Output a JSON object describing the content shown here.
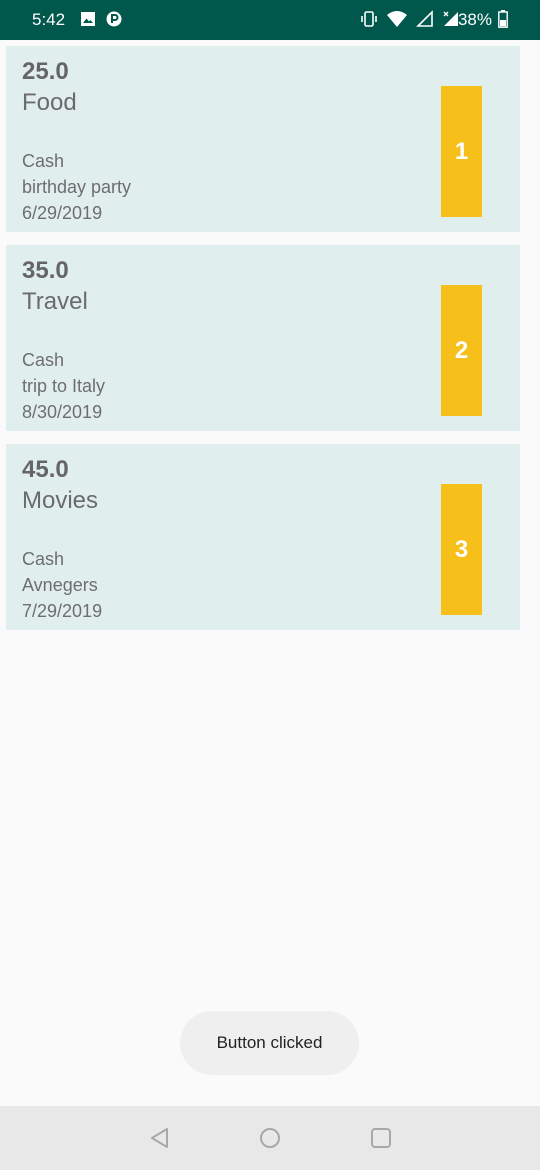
{
  "status_bar": {
    "time": "5:42",
    "battery": "38%",
    "left_icons": [
      "image-icon",
      "p-icon"
    ],
    "right_icons": [
      "vibrate-icon",
      "wifi-icon",
      "signal-icon",
      "signal-x-icon"
    ],
    "background": "#00574b"
  },
  "expenses": [
    {
      "amount": "25.0",
      "category": "Food",
      "method": "Cash",
      "description": "birthday party",
      "date": "6/29/2019",
      "badge": "1"
    },
    {
      "amount": "35.0",
      "category": "Travel",
      "method": "Cash",
      "description": "trip to Italy",
      "date": "8/30/2019",
      "badge": "2"
    },
    {
      "amount": "45.0",
      "category": "Movies",
      "method": "Cash",
      "description": "Avnegers",
      "date": "7/29/2019",
      "badge": "3"
    }
  ],
  "toast": {
    "message": "Button clicked"
  },
  "colors": {
    "card": "#e1eeee",
    "badge": "#f6bf1a"
  },
  "nav_bar": {
    "buttons": [
      "back-icon",
      "home-icon",
      "recents-icon"
    ]
  }
}
